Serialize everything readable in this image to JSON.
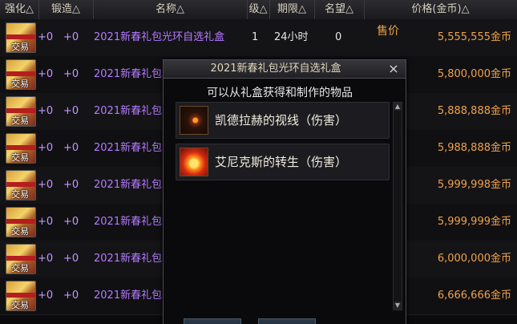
{
  "header": {
    "cols": [
      "强化△",
      "锻造△",
      "名称△",
      "级△",
      "期限△",
      "名望△",
      "价格(金币)△"
    ]
  },
  "buy_label": "售价",
  "rows": [
    {
      "enhance": "+0",
      "forge": "+0",
      "name": "2021新春礼包光环自选礼盒",
      "level": "1",
      "period": "24小时",
      "fame": "0",
      "price": "5,555,555金币",
      "trade": "交易"
    },
    {
      "enhance": "+0",
      "forge": "+0",
      "name": "2021新春礼包",
      "level": "",
      "period": "",
      "fame": "",
      "price": "5,800,000金币",
      "trade": "交易"
    },
    {
      "enhance": "+0",
      "forge": "+0",
      "name": "2021新春礼包",
      "level": "",
      "period": "",
      "fame": "",
      "price": "5,888,888金币",
      "trade": "交易"
    },
    {
      "enhance": "+0",
      "forge": "+0",
      "name": "2021新春礼包",
      "level": "",
      "period": "",
      "fame": "",
      "price": "5,988,888金币",
      "trade": "交易"
    },
    {
      "enhance": "+0",
      "forge": "+0",
      "name": "2021新春礼包",
      "level": "",
      "period": "",
      "fame": "",
      "price": "5,999,998金币",
      "trade": "交易"
    },
    {
      "enhance": "+0",
      "forge": "+0",
      "name": "2021新春礼包",
      "level": "",
      "period": "",
      "fame": "",
      "price": "5,999,999金币",
      "trade": "交易"
    },
    {
      "enhance": "+0",
      "forge": "+0",
      "name": "2021新春礼包",
      "level": "",
      "period": "",
      "fame": "",
      "price": "6,000,000金币",
      "trade": "交易"
    },
    {
      "enhance": "+0",
      "forge": "+0",
      "name": "2021新春礼包",
      "level": "",
      "period": "",
      "fame": "",
      "price": "6,666,666金币",
      "trade": "交易"
    }
  ],
  "dialog": {
    "title": "2021新春礼包光环自选礼盒",
    "close": "×",
    "subtitle": "可以从礼盒获得和制作的物品",
    "items": [
      {
        "label": "凯德拉赫的视线（伤害）",
        "icon": "dark-eye-icon"
      },
      {
        "label": "艾尼克斯的转生（伤害）",
        "icon": "phoenix-icon"
      }
    ]
  }
}
